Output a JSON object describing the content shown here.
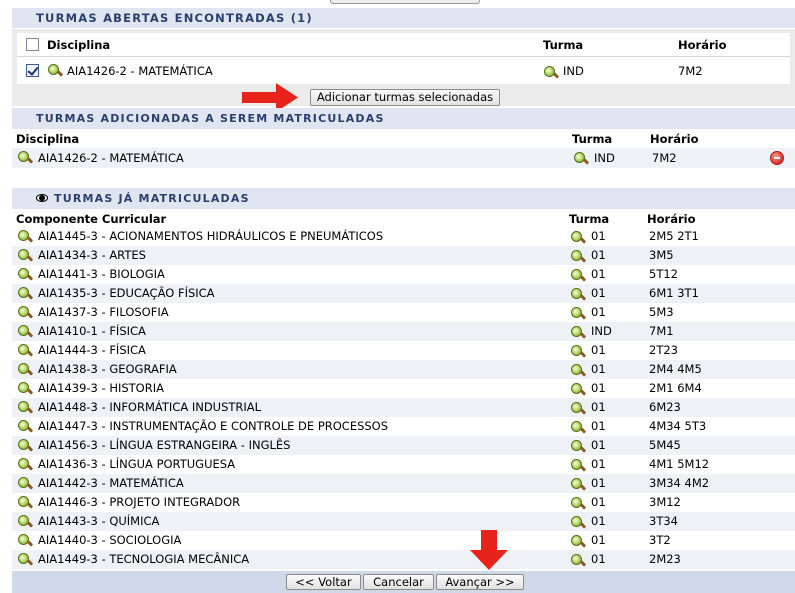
{
  "open_classes": {
    "title": "Turmas abertas encontradas (1)",
    "headers": {
      "disciplina": "Disciplina",
      "turma": "Turma",
      "horario": "Horário"
    },
    "rows": [
      {
        "disciplina": "AIA1426-2 - MATEMÁTICA",
        "turma": "IND",
        "horario": "7M2",
        "checked": true
      }
    ],
    "add_button": "Adicionar turmas selecionadas"
  },
  "added_classes": {
    "title": "Turmas adicionadas a serem matriculadas",
    "headers": {
      "disciplina": "Disciplina",
      "turma": "Turma",
      "horario": "Horário"
    },
    "rows": [
      {
        "disciplina": "AIA1426-2 - MATEMÁTICA",
        "turma": "IND",
        "horario": "7M2"
      }
    ]
  },
  "enrolled_classes": {
    "title": "Turmas já matriculadas",
    "headers": {
      "componente": "Componente Curricular",
      "turma": "Turma",
      "horario": "Horário"
    },
    "rows": [
      {
        "componente": "AIA1445-3 - ACIONAMENTOS HIDRÁULICOS E PNEUMÁTICOS",
        "turma": "01",
        "horario": "2M5 2T1"
      },
      {
        "componente": "AIA1434-3 - ARTES",
        "turma": "01",
        "horario": "3M5"
      },
      {
        "componente": "AIA1441-3 - BIOLOGIA",
        "turma": "01",
        "horario": "5T12"
      },
      {
        "componente": "AIA1435-3 - EDUCAÇÃO FÍSICA",
        "turma": "01",
        "horario": "6M1 3T1"
      },
      {
        "componente": "AIA1437-3 - FILOSOFIA",
        "turma": "01",
        "horario": "5M3"
      },
      {
        "componente": "AIA1410-1 - FÍSICA",
        "turma": "IND",
        "horario": "7M1"
      },
      {
        "componente": "AIA1444-3 - FÍSICA",
        "turma": "01",
        "horario": "2T23"
      },
      {
        "componente": "AIA1438-3 - GEOGRAFIA",
        "turma": "01",
        "horario": "2M4 4M5"
      },
      {
        "componente": "AIA1439-3 - HISTORIA",
        "turma": "01",
        "horario": "2M1 6M4"
      },
      {
        "componente": "AIA1448-3 - INFORMÁTICA INDUSTRIAL",
        "turma": "01",
        "horario": "6M23"
      },
      {
        "componente": "AIA1447-3 - INSTRUMENTAÇÃO E CONTROLE DE PROCESSOS",
        "turma": "01",
        "horario": "4M34 5T3"
      },
      {
        "componente": "AIA1456-3 - LÍNGUA ESTRANGEIRA - INGLÊS",
        "turma": "01",
        "horario": "5M45"
      },
      {
        "componente": "AIA1436-3 - LÍNGUA PORTUGUESA",
        "turma": "01",
        "horario": "4M1 5M12"
      },
      {
        "componente": "AIA1442-3 - MATEMÁTICA",
        "turma": "01",
        "horario": "3M34 4M2"
      },
      {
        "componente": "AIA1446-3 - PROJETO INTEGRADOR",
        "turma": "01",
        "horario": "3M12"
      },
      {
        "componente": "AIA1443-3 - QUÍMICA",
        "turma": "01",
        "horario": "3T34"
      },
      {
        "componente": "AIA1440-3 - SOCIOLOGIA",
        "turma": "01",
        "horario": "3T2"
      },
      {
        "componente": "AIA1449-3 - TECNOLOGIA MECÂNICA",
        "turma": "01",
        "horario": "2M23"
      }
    ]
  },
  "nav": {
    "back": "<< Voltar",
    "cancel": "Cancelar",
    "next": "Avançar >>"
  },
  "icons": {
    "view_detail": "magnifier-icon",
    "remove": "remove-icon",
    "eye": "eye-icon"
  },
  "colors": {
    "section_header_bg": "#dfe6f2",
    "section_header_text": "#2b3f6b",
    "footer_bg": "#cfd8e8",
    "annotation_arrow": "#e8231c"
  }
}
